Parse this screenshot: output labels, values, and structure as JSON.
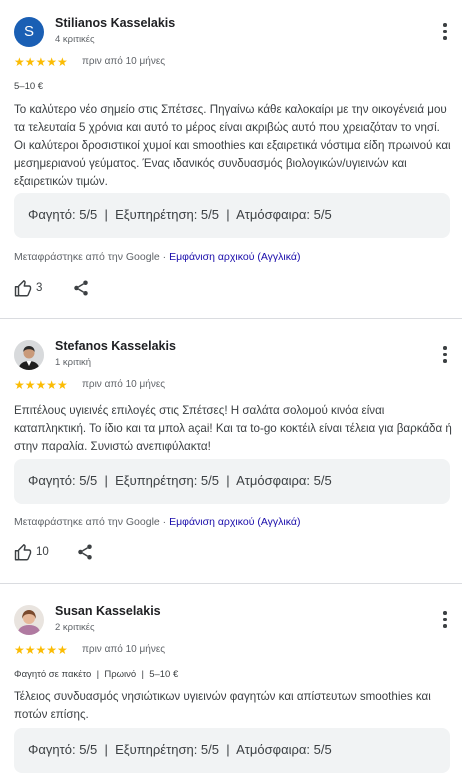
{
  "reviews": [
    {
      "avatar_letter": "S",
      "name": "Stilianos Kasselakis",
      "review_count": "4 κριτικές",
      "stars": "★★★★★",
      "time": "πριν από 10 μήνες",
      "meta": "5–10 €",
      "text": "Το καλύτερο νέο σημείο στις Σπέτσες. Πηγαίνω κάθε καλοκαίρι με την οικογένειά μου τα τελευταία 5 χρόνια και αυτό το μέρος είναι ακριβώς αυτό που χρειαζόταν το νησί. Οι καλύτεροι δροσιστικοί χυμοί και smoothies και εξαιρετικά νόστιμα είδη πρωινού και μεσημεριανού γεύματος. Ένας ιδανικός συνδυασμός βιολογικών/υγιεινών και εξαιρετικών τιμών.",
      "ratings": "Φαγητό: 5/5  |  Εξυπηρέτηση: 5/5  |  Ατμόσφαιρα: 5/5",
      "translated_prefix": "Μεταφράστηκε από την Google · ",
      "translated_link": "Εμφάνιση αρχικού (Αγγλικά)",
      "likes": "3"
    },
    {
      "name": "Stefanos Kasselakis",
      "review_count": "1 κριτική",
      "stars": "★★★★★",
      "time": "πριν από 10 μήνες",
      "text": "Επιτέλους υγιεινές επιλογές στις Σπέτσες! Η σαλάτα σολομού κινόα είναι καταπληκτική. Το ίδιο και τα μπολ açai! Και τα to-go κοκτέιλ είναι τέλεια για βαρκάδα ή στην παραλία. Συνιστώ ανεπιφύλακτα!",
      "ratings": "Φαγητό: 5/5  |  Εξυπηρέτηση: 5/5  |  Ατμόσφαιρα: 5/5",
      "translated_prefix": "Μεταφράστηκε από την Google · ",
      "translated_link": "Εμφάνιση αρχικού (Αγγλικά)",
      "likes": "10"
    },
    {
      "name": "Susan Kasselakis",
      "review_count": "2 κριτικές",
      "stars": "★★★★★",
      "time": "πριν από 10 μήνες",
      "meta": "Φαγητό σε πακέτο  |  Πρωινό  |  5–10 €",
      "text": "Τέλειος συνδυασμός νησιώτικων υγιεινών φαγητών και απίστευτων smoothies και ποτών επίσης.",
      "ratings": "Φαγητό: 5/5  |  Εξυπηρέτηση: 5/5  |  Ατμόσφαιρα: 5/5"
    }
  ],
  "colors": {
    "star": "#fbbc04",
    "avatar_blue": "#1a5fb4",
    "link": "#1a0dab",
    "box": "#f1f3f4"
  }
}
